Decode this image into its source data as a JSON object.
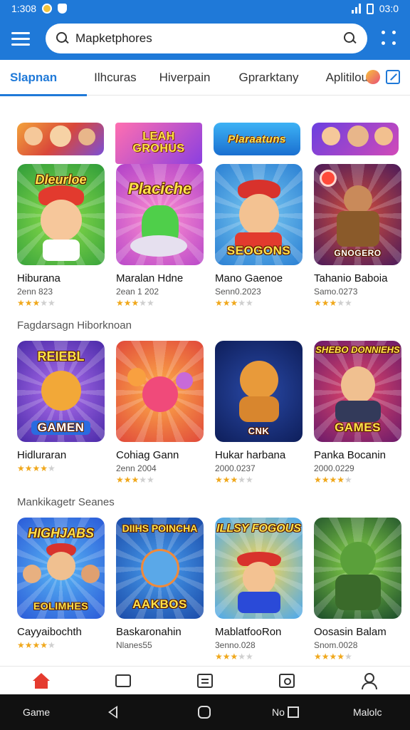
{
  "status_bar": {
    "time": "1:308",
    "right_text": "03:0"
  },
  "search": {
    "value": "Mapketphores",
    "placeholder": "Mapketphores"
  },
  "tabs": [
    {
      "label": "Slapnan",
      "active": true
    },
    {
      "label": "Ilhcuras",
      "active": false
    },
    {
      "label": "Hiverpain",
      "active": false
    },
    {
      "label": "Gprarktany",
      "active": false
    },
    {
      "label": "Aplitilou",
      "active": false
    }
  ],
  "banners": [
    "",
    "LEAH GROHUS",
    "Plaraatuns",
    ""
  ],
  "sections": [
    {
      "heading": "",
      "games": [
        {
          "title": "Hiburana",
          "subtitle": "2enn 823",
          "rating": 3,
          "art_top": "Dleurloe",
          "art_label": ""
        },
        {
          "title": "Maralan Hdne",
          "subtitle": "2ean 1 202",
          "rating": 3,
          "art_top": "Placiche",
          "art_label": ""
        },
        {
          "title": "Mano Gaenoe",
          "subtitle": "Senn0.2023",
          "rating": 3,
          "art_top": "",
          "art_label": "SEOGONS"
        },
        {
          "title": "Tahanio Baboia",
          "subtitle": "Samo.0273",
          "rating": 3,
          "art_top": "",
          "art_label": "GNOGERO"
        }
      ]
    },
    {
      "heading": "Fagdarsagn Hiborknoan",
      "games": [
        {
          "title": "Hidluraran",
          "subtitle": "",
          "rating": 4,
          "art_top": "REIEBL",
          "art_label": "GAMEN"
        },
        {
          "title": "Cohiag Gann",
          "subtitle": "2enn 2004",
          "rating": 3,
          "art_top": "",
          "art_label": ""
        },
        {
          "title": "Hukar harbana",
          "subtitle": "2000.0237",
          "rating": 3,
          "art_top": "",
          "art_label": "CNK"
        },
        {
          "title": "Panka Bocanin",
          "subtitle": "2000.0229",
          "rating": 4,
          "art_top": "SHEBO DONNIEHS",
          "art_label": "GAMES"
        }
      ]
    },
    {
      "heading": "Mankikagetr Seanes",
      "games": [
        {
          "title": "Cayyaibochth",
          "subtitle": "",
          "rating": 4,
          "art_top": "HIGHJABS",
          "art_label": "EOLIMHES"
        },
        {
          "title": "Baskaronahin",
          "subtitle": "Nlanes55",
          "rating": 0,
          "art_top": "DIIHS POINCHA",
          "art_label": "AAKBOS"
        },
        {
          "title": "MablatfooRon",
          "subtitle": "3enno.028",
          "rating": 3,
          "art_top": "ILLSY FOGOUS",
          "art_label": ""
        },
        {
          "title": "Oosasin Balam",
          "subtitle": "Snom.0028",
          "rating": 4,
          "art_top": "",
          "art_label": ""
        }
      ]
    }
  ],
  "bottom_nav": [
    {
      "icon": "home-icon"
    },
    {
      "icon": "square-icon"
    },
    {
      "icon": "doc-icon"
    },
    {
      "icon": "gallery-icon"
    },
    {
      "icon": "profile-icon"
    }
  ],
  "system_nav": {
    "left_label": "Game",
    "middle_label": "No",
    "right_label": "Malolc"
  },
  "colors": {
    "primary": "#1f79d8",
    "star": "#f0a81c",
    "home": "#e53b2f"
  }
}
